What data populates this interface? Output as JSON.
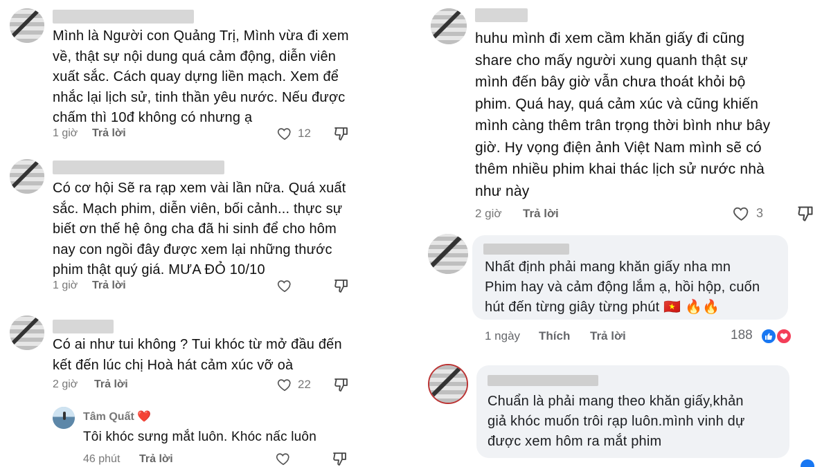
{
  "left": {
    "comments": [
      {
        "text": "Mình là Người con Quảng Trị, Mình vừa đi xem\nvề, thật sự nội dung quá cảm động, diễn viên\nxuất sắc. Cách quay dựng liền mạch. Xem để\nnhắc lại lịch sử, tinh thần yêu nước. Nếu được\nchấm thì 10đ không có nhưng ạ",
        "time": "1 giờ",
        "reply": "Trả lời",
        "likes": "12"
      },
      {
        "text": "Có cơ hội Sẽ ra rạp xem vài lần nữa. Quá xuất\nsắc. Mạch phim, diễn viên, bối cảnh... thực sự\nbiết ơn thế hệ ông cha đã hi sinh để cho hôm\nnay con ngồi đây được xem lại những thước\nphim thật quý giá. MƯA ĐỎ 10/10",
        "time": "1 giờ",
        "reply": "Trả lời",
        "likes": ""
      },
      {
        "text": "Có ai như tui không ? Tui khóc từ mở đầu đến\nkết đến lúc chị Hoà hát cảm xúc vỡ oà",
        "time": "2 giờ",
        "reply": "Trả lời",
        "likes": "22"
      }
    ],
    "reply": {
      "name": "Tâm Quất",
      "heart": "❤️",
      "text": "Tôi khóc sưng mắt luôn. Khóc nấc luôn",
      "time": "46 phút",
      "reply": "Trả lời"
    }
  },
  "right": {
    "top": {
      "text": "huhu mình đi xem cầm khăn giấy đi cũng\nshare cho mấy người xung quanh thật sự\nmình đến bây giờ vẫn chưa thoát khỏi bộ\nphim. Quá hay, quá cảm xúc và cũng khiến\nmình càng thêm trân trọng thời bình như bây\ngiờ. Hy vọng điện ảnh Việt Nam mình sẽ có\nthêm nhiều phim khai thác lịch sử nước nhà\nnhư này",
      "time": "2 giờ",
      "reply": "Trả lời",
      "likes": "3"
    },
    "fb1": {
      "text": "Nhất định phải mang khăn giấy nha mn\nPhim hay và cảm động lắm ạ, hồi hộp, cuốn\nhút đến từng giây từng phút 🇻🇳 🔥🔥",
      "time": "1 ngày",
      "like": "Thích",
      "reply": "Trả lời",
      "reactions": "188"
    },
    "fb2": {
      "text": "Chuẩn là phải mang theo khăn giấy,khản\ngiả khóc muốn trôi rạp luôn.mình vinh dự\nđược xem hôm ra mắt phim"
    }
  },
  "colors": {
    "like_blue": "#1877f2",
    "love_red": "#f33e58",
    "fb_bubble": "#f0f2f5"
  }
}
